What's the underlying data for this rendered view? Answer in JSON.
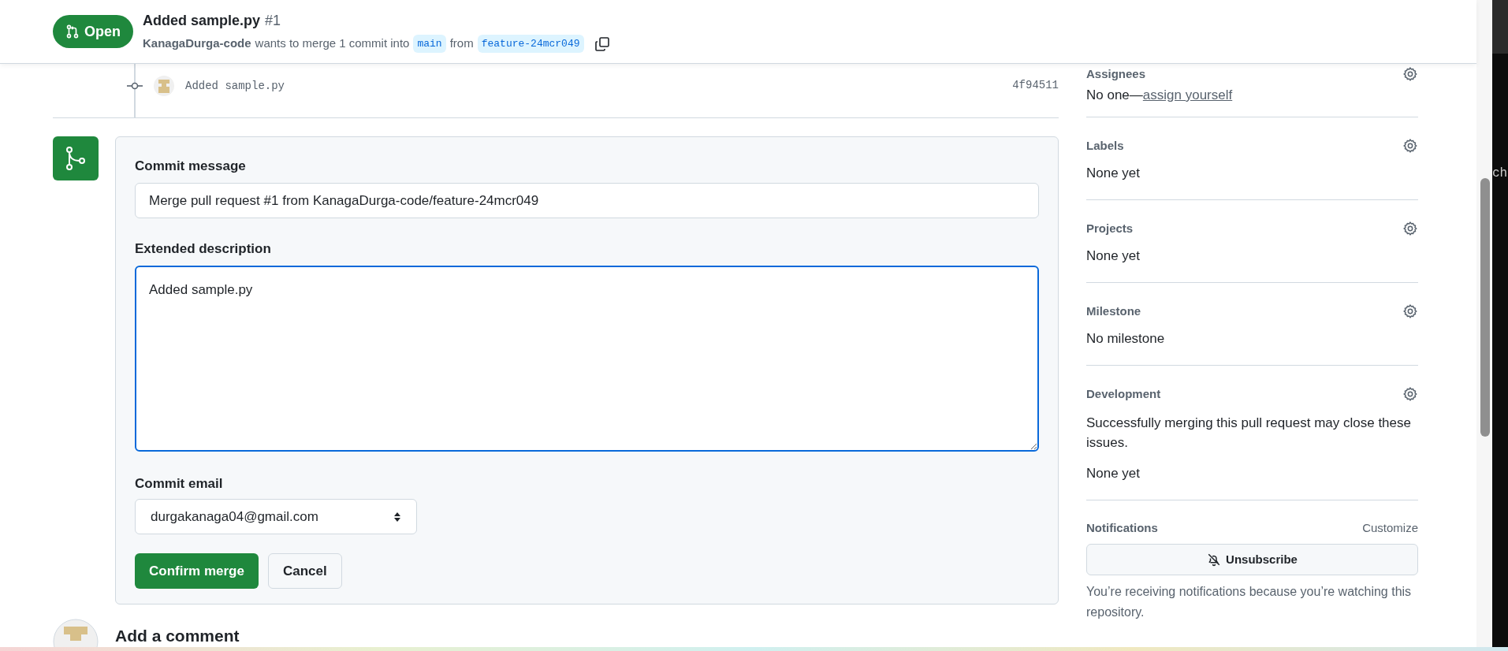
{
  "header": {
    "state": {
      "kind": "open",
      "label": "Open"
    },
    "title": "Added sample.py",
    "number": "#1",
    "author": "KanagaDurga-code",
    "summary": "wants to merge 1 commit into",
    "base_branch": "main",
    "from_word": "from",
    "head_branch": "feature-24mcr049"
  },
  "commit": {
    "message": "Added sample.py",
    "sha": "4f94511"
  },
  "merge_form": {
    "message_label": "Commit message",
    "message_value": "Merge pull request #1 from KanagaDurga-code/feature-24mcr049",
    "description_label": "Extended description",
    "description_value": "Added sample.py",
    "email_label": "Commit email",
    "email_value": "durgakanaga04@gmail.com",
    "confirm_button": "Confirm merge",
    "cancel_button": "Cancel"
  },
  "add_comment": "Add a comment",
  "sidebar": {
    "sections": [
      {
        "kind": "assignees",
        "title": "Assignees",
        "text": "No one—",
        "link": "assign yourself"
      },
      {
        "kind": "plain",
        "title": "Labels",
        "text": "None yet"
      },
      {
        "kind": "plain",
        "title": "Projects",
        "text": "None yet"
      },
      {
        "kind": "plain",
        "title": "Milestone",
        "text": "No milestone"
      },
      {
        "kind": "development",
        "title": "Development",
        "note": "Successfully merging this pull request may close these issues.",
        "text": "None yet"
      }
    ],
    "notifications": {
      "title": "Notifications",
      "customize": "Customize",
      "button": "Unsubscribe",
      "note": "You’re receiving notifications because you’re watching this repository."
    }
  },
  "background_window": {
    "text": "ch"
  }
}
